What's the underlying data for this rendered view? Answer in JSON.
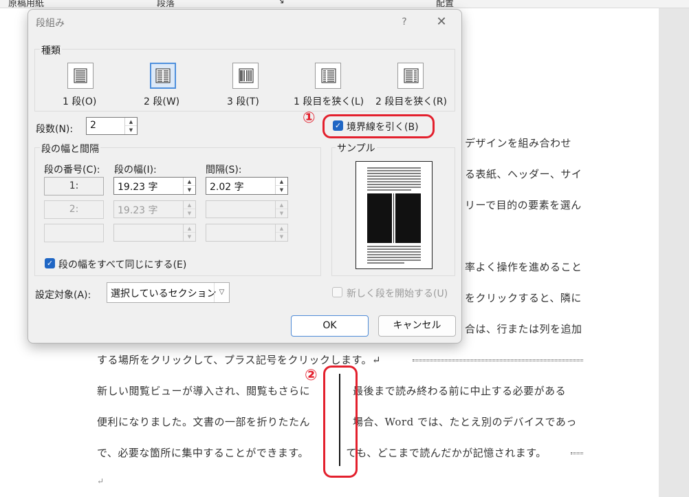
{
  "ribbon": {
    "items": [
      "原稿用紙",
      "段落",
      "↘",
      "配置"
    ]
  },
  "doc": {
    "right_lines": [
      "デザインを組み合わせ",
      "る表紙、ヘッダー、サイ",
      "リーで目的の要素を選ん",
      "率よく操作を進めること",
      "をクリックすると、隣に",
      "合は、行または列を追加"
    ],
    "full_lines": [
      "する場所をクリックして、プラス記号をクリックします。↵",
      "新しい閲覧ビューが導入され、閲覧もさらに　　　　最後まで読み終わる前に中止する必要がある",
      "便利になりました。文書の一部を折りたたん　　　　場合、Word では、たとえ別のデバイスであっ",
      "で、必要な箇所に集中することができます。　　　　ても、どこまで読んだかが記憶されます。"
    ],
    "para_mark": "↵"
  },
  "dialog": {
    "title": "段組み",
    "help": "?",
    "close": "✕",
    "presets_group": "種類",
    "presets": [
      {
        "label": "1 段(O)"
      },
      {
        "label": "2 段(W)"
      },
      {
        "label": "3 段(T)"
      },
      {
        "label": "1 段目を狭く(L)"
      },
      {
        "label": "2 段目を狭く(R)"
      }
    ],
    "num_cols_label": "段数(N):",
    "num_cols_value": "2",
    "line_between_label": "境界線を引く(B)",
    "width_group": "段の幅と間隔",
    "col_no_header": "段の番号(C):",
    "width_header": "段の幅(I):",
    "spacing_header": "間隔(S):",
    "rows": [
      {
        "num": "1:",
        "width": "19.23 字",
        "spacing": "2.02 字"
      },
      {
        "num": "2:",
        "width": "19.23 字",
        "spacing": ""
      },
      {
        "num": "",
        "width": "",
        "spacing": ""
      }
    ],
    "equal_width_label": "段の幅をすべて同じにする(E)",
    "sample_label": "サンプル",
    "apply_to_label": "設定対象(A):",
    "apply_to_value": "選択しているセクション",
    "new_column_label": "新しく段を開始する(U)",
    "ok_label": "OK",
    "cancel_label": "キャンセル"
  },
  "annotations": {
    "one": "①",
    "two": "②"
  },
  "colors": {
    "accent": "#1f66c4",
    "annotation": "#e3202d"
  }
}
